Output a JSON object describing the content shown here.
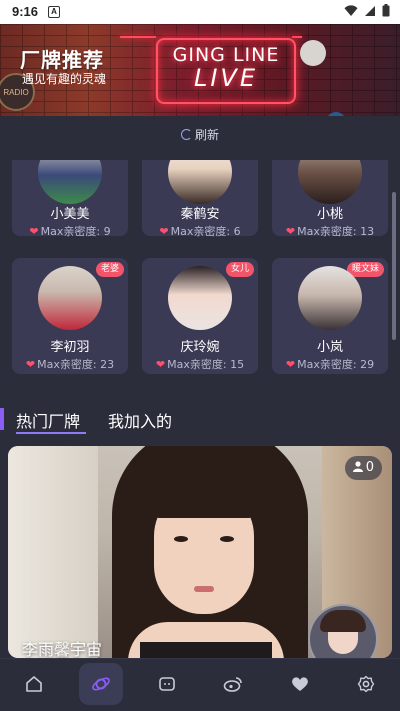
{
  "status_bar": {
    "time": "9:16",
    "notification_icon": "A"
  },
  "banner": {
    "title": "厂牌推荐",
    "subtitle": "遇见有趣的灵魂",
    "neon_line1": "GING LINE",
    "neon_line2": "LIVE",
    "sign_text": "RADIO"
  },
  "refresh": {
    "label": "刷新"
  },
  "cards": [
    {
      "name": "小美美",
      "intimacy": "Max亲密度: 9",
      "tag": ""
    },
    {
      "name": "秦鹤安",
      "intimacy": "Max亲密度: 6",
      "tag": ""
    },
    {
      "name": "小桃",
      "intimacy": "Max亲密度: 13",
      "tag": ""
    },
    {
      "name": "李初羽",
      "intimacy": "Max亲密度: 23",
      "tag": "老婆"
    },
    {
      "name": "庆玲婉",
      "intimacy": "Max亲密度: 15",
      "tag": "女儿"
    },
    {
      "name": "小岚",
      "intimacy": "Max亲密度: 29",
      "tag": "暖文妹"
    }
  ],
  "tabs": {
    "hot": "热门厂牌",
    "joined": "我加入的"
  },
  "feature": {
    "title": "李雨馨宇宙",
    "count": "0"
  },
  "nav": {
    "items": [
      "home-icon",
      "planet-icon",
      "chat-bot-icon",
      "weibo-icon",
      "heart-icon",
      "settings-icon"
    ],
    "active_index": 1
  },
  "colors": {
    "accent": "#8b5cf6",
    "background": "#2b2d3b",
    "card": "#3b3a55",
    "heart": "#ff4f6d",
    "tag": "#f2556a"
  }
}
